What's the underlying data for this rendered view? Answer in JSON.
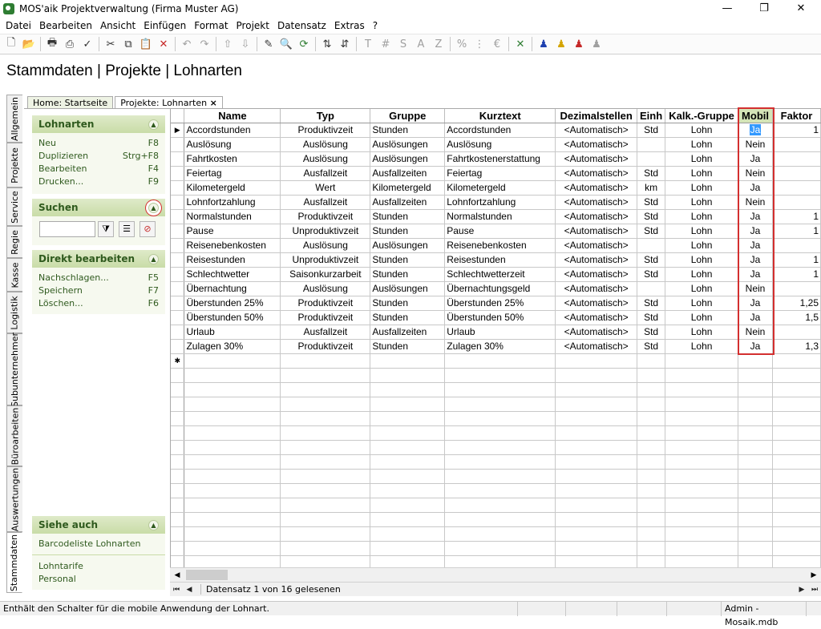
{
  "window": {
    "title": "MOS'aik Projektverwaltung (Firma Muster AG)",
    "minimize": "—",
    "restore": "❐",
    "close": "✕"
  },
  "menu": [
    "Datei",
    "Bearbeiten",
    "Ansicht",
    "Einfügen",
    "Format",
    "Projekt",
    "Datensatz",
    "Extras",
    "?"
  ],
  "breadcrumb": "Stammdaten | Projekte | Lohnarten",
  "vtabs": [
    "Allgemein",
    "Projekte",
    "Service",
    "Regie",
    "Kasse",
    "Logistik",
    "Subunternehmer",
    "Büroarbeiten",
    "Auswertungen",
    "Stammdaten"
  ],
  "doc_tabs": [
    "Home: Startseite",
    "Projekte: Lohnarten"
  ],
  "doc_tab_close": "×",
  "left_panel": {
    "lohnarten": {
      "title": "Lohnarten",
      "items": [
        {
          "label": "Neu",
          "key": "F8"
        },
        {
          "label": "Duplizieren",
          "key": "Strg+F8"
        },
        {
          "label": "Bearbeiten",
          "key": "F4"
        },
        {
          "label": "Drucken...",
          "key": "F9"
        }
      ]
    },
    "suchen": {
      "title": "Suchen"
    },
    "direkt": {
      "title": "Direkt bearbeiten",
      "items": [
        {
          "label": "Nachschlagen...",
          "key": "F5"
        },
        {
          "label": "Speichern",
          "key": "F7"
        },
        {
          "label": "Löschen...",
          "key": "F6"
        }
      ]
    },
    "siehe_auch": {
      "title": "Siehe auch",
      "items": [
        "Barcodeliste Lohnarten",
        "Lohntarife",
        "Personal"
      ]
    }
  },
  "grid": {
    "columns": [
      "Name",
      "Typ",
      "Gruppe",
      "Kurztext",
      "Dezimalstellen",
      "Einh",
      "Kalk.-Gruppe",
      "Mobil",
      "Faktor"
    ],
    "rows": [
      [
        "Accordstunden",
        "Produktivzeit",
        "Stunden",
        "Accordstunden",
        "<Automatisch>",
        "Std",
        "Lohn",
        "Ja",
        "1"
      ],
      [
        "Auslösung",
        "Auslösung",
        "Auslösungen",
        "Auslösung",
        "<Automatisch>",
        "",
        "Lohn",
        "Nein",
        ""
      ],
      [
        "Fahrtkosten",
        "Auslösung",
        "Auslösungen",
        "Fahrtkostenerstattung",
        "<Automatisch>",
        "",
        "Lohn",
        "Ja",
        ""
      ],
      [
        "Feiertag",
        "Ausfallzeit",
        "Ausfallzeiten",
        "Feiertag",
        "<Automatisch>",
        "Std",
        "Lohn",
        "Nein",
        ""
      ],
      [
        "Kilometergeld",
        "Wert",
        "Kilometergeld",
        "Kilometergeld",
        "<Automatisch>",
        "km",
        "Lohn",
        "Ja",
        ""
      ],
      [
        "Lohnfortzahlung",
        "Ausfallzeit",
        "Ausfallzeiten",
        "Lohnfortzahlung",
        "<Automatisch>",
        "Std",
        "Lohn",
        "Nein",
        ""
      ],
      [
        "Normalstunden",
        "Produktivzeit",
        "Stunden",
        "Normalstunden",
        "<Automatisch>",
        "Std",
        "Lohn",
        "Ja",
        "1"
      ],
      [
        "Pause",
        "Unproduktivzeit",
        "Stunden",
        "Pause",
        "<Automatisch>",
        "Std",
        "Lohn",
        "Ja",
        "1"
      ],
      [
        "Reisenebenkosten",
        "Auslösung",
        "Auslösungen",
        "Reisenebenkosten",
        "<Automatisch>",
        "",
        "Lohn",
        "Ja",
        ""
      ],
      [
        "Reisestunden",
        "Unproduktivzeit",
        "Stunden",
        "Reisestunden",
        "<Automatisch>",
        "Std",
        "Lohn",
        "Ja",
        "1"
      ],
      [
        "Schlechtwetter",
        "Saisonkurzarbeit",
        "Stunden",
        "Schlechtwetterzeit",
        "<Automatisch>",
        "Std",
        "Lohn",
        "Ja",
        "1"
      ],
      [
        "Übernachtung",
        "Auslösung",
        "Auslösungen",
        "Übernachtungsgeld",
        "<Automatisch>",
        "",
        "Lohn",
        "Nein",
        ""
      ],
      [
        "Überstunden 25%",
        "Produktivzeit",
        "Stunden",
        "Überstunden 25%",
        "<Automatisch>",
        "Std",
        "Lohn",
        "Ja",
        "1,25"
      ],
      [
        "Überstunden 50%",
        "Produktivzeit",
        "Stunden",
        "Überstunden 50%",
        "<Automatisch>",
        "Std",
        "Lohn",
        "Ja",
        "1,5"
      ],
      [
        "Urlaub",
        "Ausfallzeit",
        "Ausfallzeiten",
        "Urlaub",
        "<Automatisch>",
        "Std",
        "Lohn",
        "Nein",
        ""
      ],
      [
        "Zulagen 30%",
        "Produktivzeit",
        "Stunden",
        "Zulagen 30%",
        "<Automatisch>",
        "Std",
        "Lohn",
        "Ja",
        "1,3"
      ]
    ],
    "current_row_marker": "▶",
    "new_row_marker": "✱"
  },
  "navigator": {
    "text": "Datensatz 1 von 16 gelesenen"
  },
  "status": {
    "hint": "Enthält den Schalter für die mobile Anwendung der Lohnart.",
    "user": "Admin - Mosaik.mdb"
  },
  "colors": {
    "accent_green": "#2f5a1e",
    "panel_head": "#d4e4b7",
    "highlight": "#d32f2f",
    "selection": "#3399ff"
  }
}
